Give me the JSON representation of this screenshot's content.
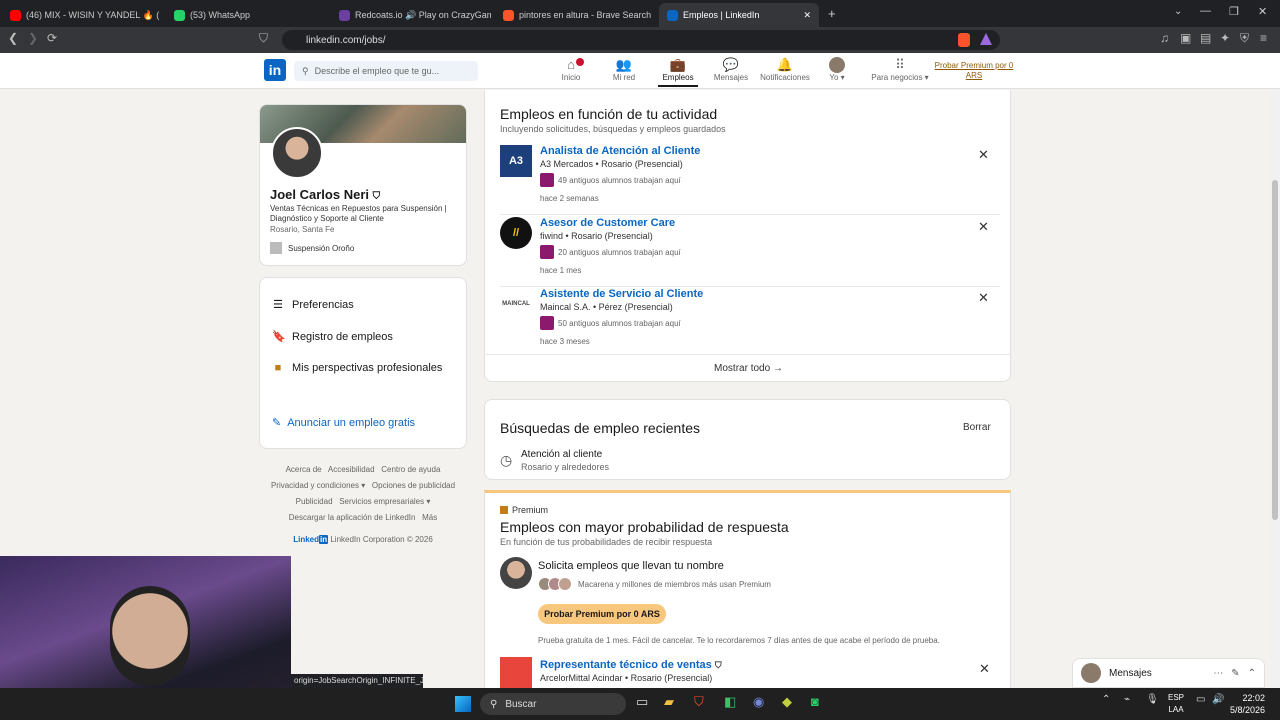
{
  "browser": {
    "tabs": [
      {
        "label": "(46) MIX - WISIN Y YANDEL 🔥 (E",
        "color": "#ff0000"
      },
      {
        "label": "(53) WhatsApp",
        "color": "#25d366"
      },
      {
        "label": "Redcoats.io 🔊 Play on CrazyGames",
        "color": "#6b3fa0"
      },
      {
        "label": "pintores en altura - Brave Search",
        "color": "#fb542b"
      },
      {
        "label": "Empleos | LinkedIn",
        "color": "#0a66c2"
      }
    ],
    "url": "linkedin.com/jobs/"
  },
  "header": {
    "logo": "in",
    "search_placeholder": "Describe el empleo que te gu...",
    "nav": [
      {
        "label": "Inicio",
        "icon": "home-icon"
      },
      {
        "label": "Mi red",
        "icon": "network-icon"
      },
      {
        "label": "Empleos",
        "icon": "briefcase-icon"
      },
      {
        "label": "Mensajes",
        "icon": "message-icon"
      },
      {
        "label": "Notificaciones",
        "icon": "bell-icon"
      },
      {
        "label": "Yo",
        "icon": "avatar"
      },
      {
        "label": "Para negocios",
        "icon": "grid-icon"
      }
    ],
    "premium_link": "Probar Premium por 0 ARS"
  },
  "profile": {
    "name": "Joel Carlos Neri",
    "headline": "Ventas Técnicas en Repuestos para Suspensión | Diagnóstico y Soporte al Cliente",
    "location": "Rosario, Santa Fe",
    "company": "Suspensión Oroño"
  },
  "menu": {
    "items": [
      "Preferencias",
      "Registro de empleos",
      "Mis perspectivas profesionales"
    ],
    "post_job": "Anunciar un empleo gratis"
  },
  "footer": {
    "links": [
      "Acerca de",
      "Accesibilidad",
      "Centro de ayuda",
      "Privacidad y condiciones",
      "Opciones de publicidad",
      "Publicidad",
      "Servicios empresariales",
      "Descargar la aplicación de LinkedIn",
      "Más"
    ],
    "brand": "Linked",
    "copyright": "LinkedIn Corporation © 2026"
  },
  "activity": {
    "title": "Empleos en función de tu actividad",
    "subtitle": "Incluyendo solicitudes, búsquedas y empleos guardados",
    "jobs": [
      {
        "logo": "A3",
        "logo_color": "#1d3f7c",
        "title": "Analista de Atención al Cliente",
        "company": "A3 Mercados • Rosario (Presencial)",
        "alumni": "49 antiguos alumnos trabajan aquí",
        "time": "hace 2 semanas"
      },
      {
        "logo": "//",
        "logo_color": "#111111",
        "title": "Asesor de Customer Care",
        "company": "fiwind • Rosario (Presencial)",
        "alumni": "20 antiguos alumnos trabajan aquí",
        "time": "hace 1 mes"
      },
      {
        "logo": "MAINCAL",
        "logo_color": "#ffffff",
        "title": "Asistente de Servicio al Cliente",
        "company": "Maincal S.A. • Pérez (Presencial)",
        "alumni": "50 antiguos alumnos trabajan aquí",
        "time": "hace 3 meses"
      }
    ],
    "show_all": "Mostrar todo →"
  },
  "recent": {
    "title": "Búsquedas de empleo recientes",
    "clear": "Borrar",
    "query": "Atención al cliente",
    "location": "Rosario y alrededores"
  },
  "premium": {
    "badge": "Premium",
    "title": "Empleos con mayor probabilidad de respuesta",
    "subtitle": "En función de tus probabilidades de recibir respuesta",
    "promo_title": "Solicita empleos que llevan tu nombre",
    "promo_members": "Macarena y millones de miembros más usan Premium",
    "promo_button": "Probar Premium por 0 ARS",
    "trial_note": "Prueba gratuita de 1 mes. Fácil de cancelar. Te lo recordaremos 7 días antes de que acabe el período de prueba.",
    "job_title": "Representante técnico de ventas",
    "job_company": "ArcelorMittal Acindar • Rosario (Presencial)"
  },
  "messages_label": "Mensajes",
  "status_url": "origin=JobSearchOrigin_INFINITE_J...",
  "taskbar": {
    "search": "Buscar",
    "lang1": "ESP",
    "lang2": "LAA",
    "time": "22:02",
    "date": "5/8/2026"
  }
}
